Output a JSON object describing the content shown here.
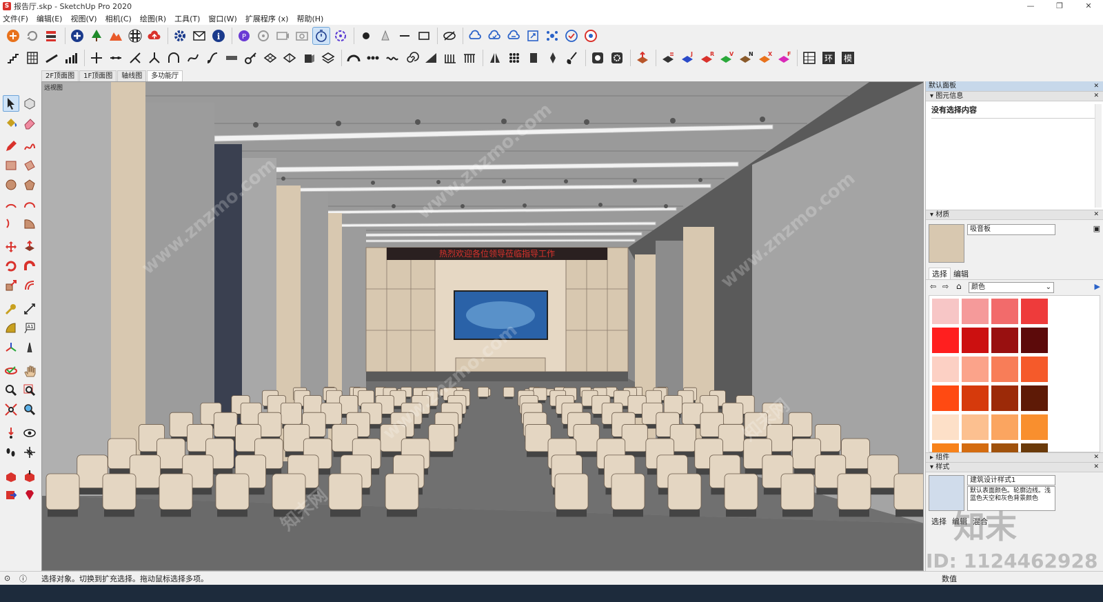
{
  "window": {
    "title": "报告厅.skp - SketchUp Pro 2020",
    "app_icon_letter": "S",
    "controls": [
      "—",
      "❐",
      "✕"
    ]
  },
  "menu": [
    "文件(F)",
    "编辑(E)",
    "视图(V)",
    "相机(C)",
    "绘图(R)",
    "工具(T)",
    "窗口(W)",
    "扩展程序 (x)",
    "帮助(H)"
  ],
  "scenes": [
    "2F顶面图",
    "1F顶面图",
    "轴线图",
    "多功能厅"
  ],
  "active_scene": "多功能厅",
  "viewport": {
    "label": "远视图",
    "led_text": "热烈欢迎各位领导莅临指导工作"
  },
  "right_panel": {
    "title": "默认面板",
    "entity_info": {
      "header": "图元信息",
      "status": "没有选择内容"
    },
    "materials": {
      "header": "材质",
      "material_name": "吸音板",
      "tab_select": "选择",
      "tab_edit": "编辑",
      "library": "颜色",
      "swatches": [
        "#f7c6c6",
        "#f59a9a",
        "#f26b6b",
        "#ee3b3b",
        "#ff1f1f",
        "#cc1010",
        "#991010",
        "#5c0a0a",
        "#fcd0c4",
        "#fba38a",
        "#f87d58",
        "#f55a2a",
        "#ff4a12",
        "#d63a0c",
        "#9c2a08",
        "#5e1a06",
        "#fde0c8",
        "#fcc090",
        "#fba560",
        "#f98f2e",
        "#f7821a",
        "#d46c10",
        "#a0520c",
        "#6a3a0a"
      ]
    },
    "components": {
      "header": "组件"
    },
    "styles": {
      "header": "样式",
      "style_name": "建筑设计样式1",
      "description": "默认表面颜色。轮廓边线。浅蓝色天空和灰色背景颜色",
      "tab_select": "选择",
      "tab_edit": "编辑",
      "tab_mix": "混合"
    }
  },
  "status": {
    "message": "选择对象。切换到扩充选择。拖动鼠标选择多项。",
    "measure_label": "数值"
  },
  "watermark": {
    "id_text": "ID: 1124462928",
    "logo_text": "知末",
    "site": "www.znzmo.com",
    "brand": "知末网"
  }
}
